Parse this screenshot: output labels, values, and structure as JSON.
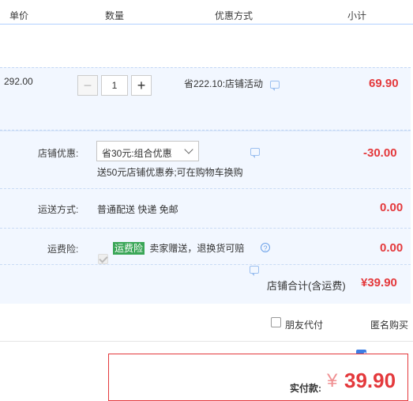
{
  "header": {
    "unit_price": "单价",
    "quantity": "数量",
    "discount_method": "优惠方式",
    "subtotal": "小计"
  },
  "item": {
    "unit_price": "292.00",
    "quantity": "1",
    "minus": "−",
    "plus": "+",
    "discount_text": "省222.10:店铺活动",
    "subtotal": "69.90"
  },
  "shop": {
    "discount_label": "店铺优惠:",
    "discount_select": "省30元:组合优惠",
    "coupon_note": "送50元店铺优惠券;可在购物车换购",
    "discount_amount": "-30.00",
    "shipping_label": "运送方式:",
    "shipping_text": "普通配送 快递 免邮",
    "shipping_amount": "0.00",
    "insurance_label": "运费险:",
    "insurance_tag": "运费险",
    "insurance_text": "卖家赠送，退换货可赔",
    "insurance_amount": "0.00",
    "total_label": "店铺合计(含运费)",
    "total_amount": "¥39.90"
  },
  "options": {
    "friend_pay": "朋友代付",
    "anonymous": "匿名购买"
  },
  "payment": {
    "label": "实付款:",
    "currency": "¥",
    "amount": "39.90"
  },
  "colors": {
    "accent_red": "#e4393c",
    "accent_blue": "#3d7de4",
    "tag_green": "#3aa657"
  }
}
